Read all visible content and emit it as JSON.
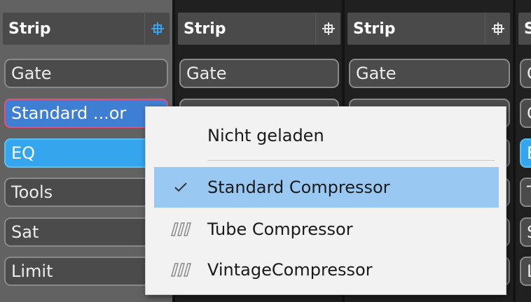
{
  "strips": [
    {
      "title": "Strip",
      "slots": [
        "Gate",
        "Standard ...or",
        "EQ",
        "Tools",
        "Sat",
        "Limit"
      ]
    },
    {
      "title": "Strip",
      "slots": [
        "Gate"
      ]
    },
    {
      "title": "Strip",
      "slots": [
        "Gate"
      ]
    },
    {
      "title": "S"
    }
  ],
  "partial_slots": [
    "G",
    "G",
    "E",
    "T",
    "S",
    "L"
  ],
  "colors": {
    "active_slot": "#35a6ee",
    "selected_slot_border": "#e3507a",
    "link_icon_active": "#3aa3f0",
    "menu_highlight": "#99c9f3"
  },
  "menu": {
    "items": [
      {
        "label": "Nicht geladen",
        "icon": ""
      },
      {
        "label": "Standard Compressor",
        "icon": "checkmark-icon",
        "checked": true
      },
      {
        "label": "Tube Compressor",
        "icon": "plugin-strip-icon"
      },
      {
        "label": "VintageCompressor",
        "icon": "plugin-strip-icon"
      }
    ]
  }
}
